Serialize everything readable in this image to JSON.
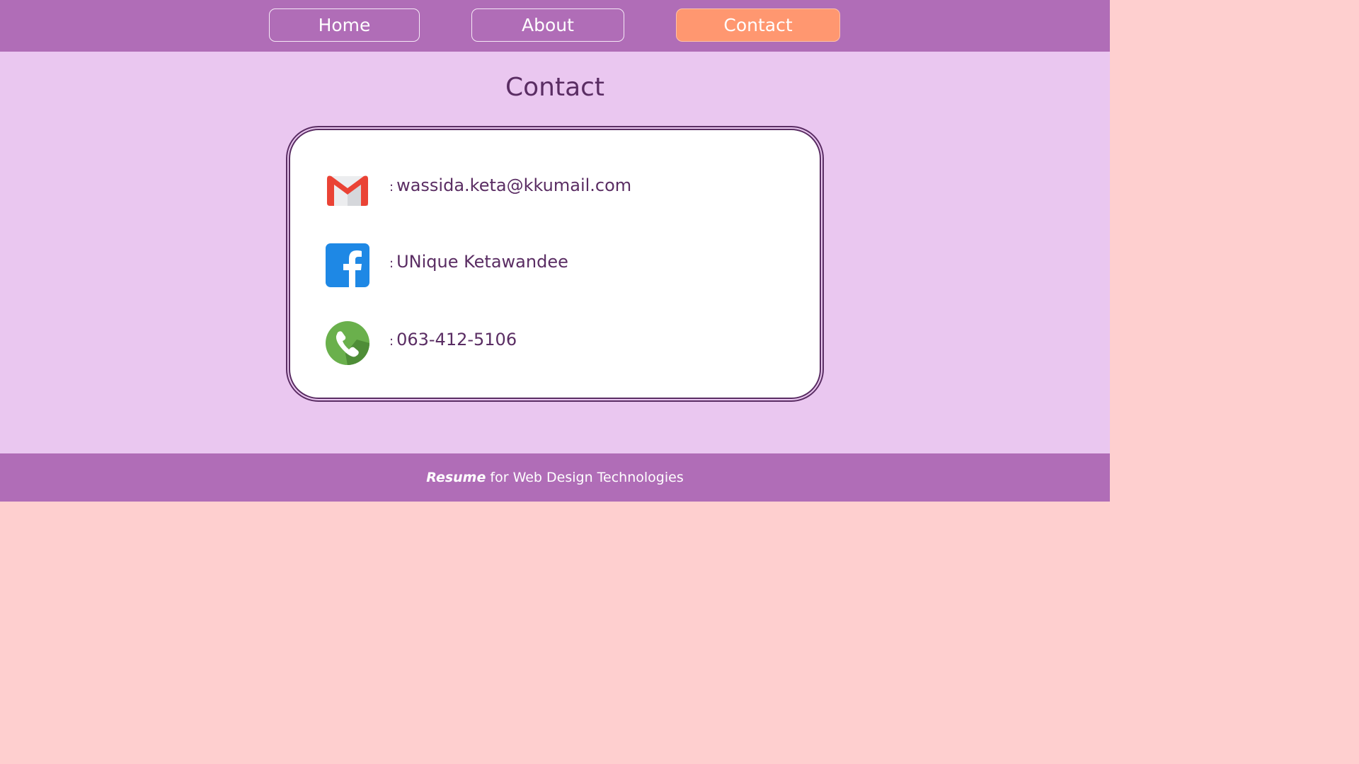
{
  "nav": {
    "items": [
      {
        "label": "Home",
        "active": false
      },
      {
        "label": "About",
        "active": false
      },
      {
        "label": "Contact",
        "active": true
      }
    ],
    "active_color": "#ff9770",
    "bar_color": "#b06db7"
  },
  "main": {
    "title": "Contact",
    "background": "#eac7f0"
  },
  "contacts": [
    {
      "icon": "gmail-icon",
      "separator": ":",
      "value": "wassida.keta@kkumail.com"
    },
    {
      "icon": "facebook-icon",
      "separator": ":",
      "value": "UNique Ketawandee"
    },
    {
      "icon": "phone-icon",
      "separator": ":",
      "value": "063-412-5106"
    }
  ],
  "footer": {
    "brand": "Resume",
    "text": " for Web Design Technologies"
  }
}
